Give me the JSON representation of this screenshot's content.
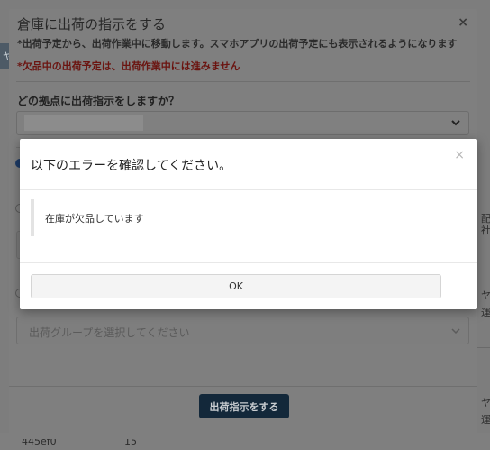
{
  "background": {
    "left_button_label": "ヤ",
    "row_cells": [
      "445ef0",
      "15"
    ],
    "right_column": [
      "配",
      "社",
      "ヤ",
      "運",
      "ヤ",
      "運"
    ]
  },
  "outer_modal": {
    "title": "倉庫に出荷の指示をする",
    "close_glyph": "×",
    "note": "*出荷予定から、出荷作業中に移動します。スマホアプリの出荷予定にも表示されるようになります",
    "warning": "*欠品中の出荷予定は、出荷作業中には進みません",
    "question": "どの拠点に出荷指示をしますか？",
    "group_select_placeholder": "出荷グループを選択してください",
    "submit_label": "出荷指示をする"
  },
  "error_dialog": {
    "title": "以下のエラーを確認してください。",
    "close_glyph": "×",
    "message": "在庫が欠品しています",
    "ok_label": "OK"
  }
}
